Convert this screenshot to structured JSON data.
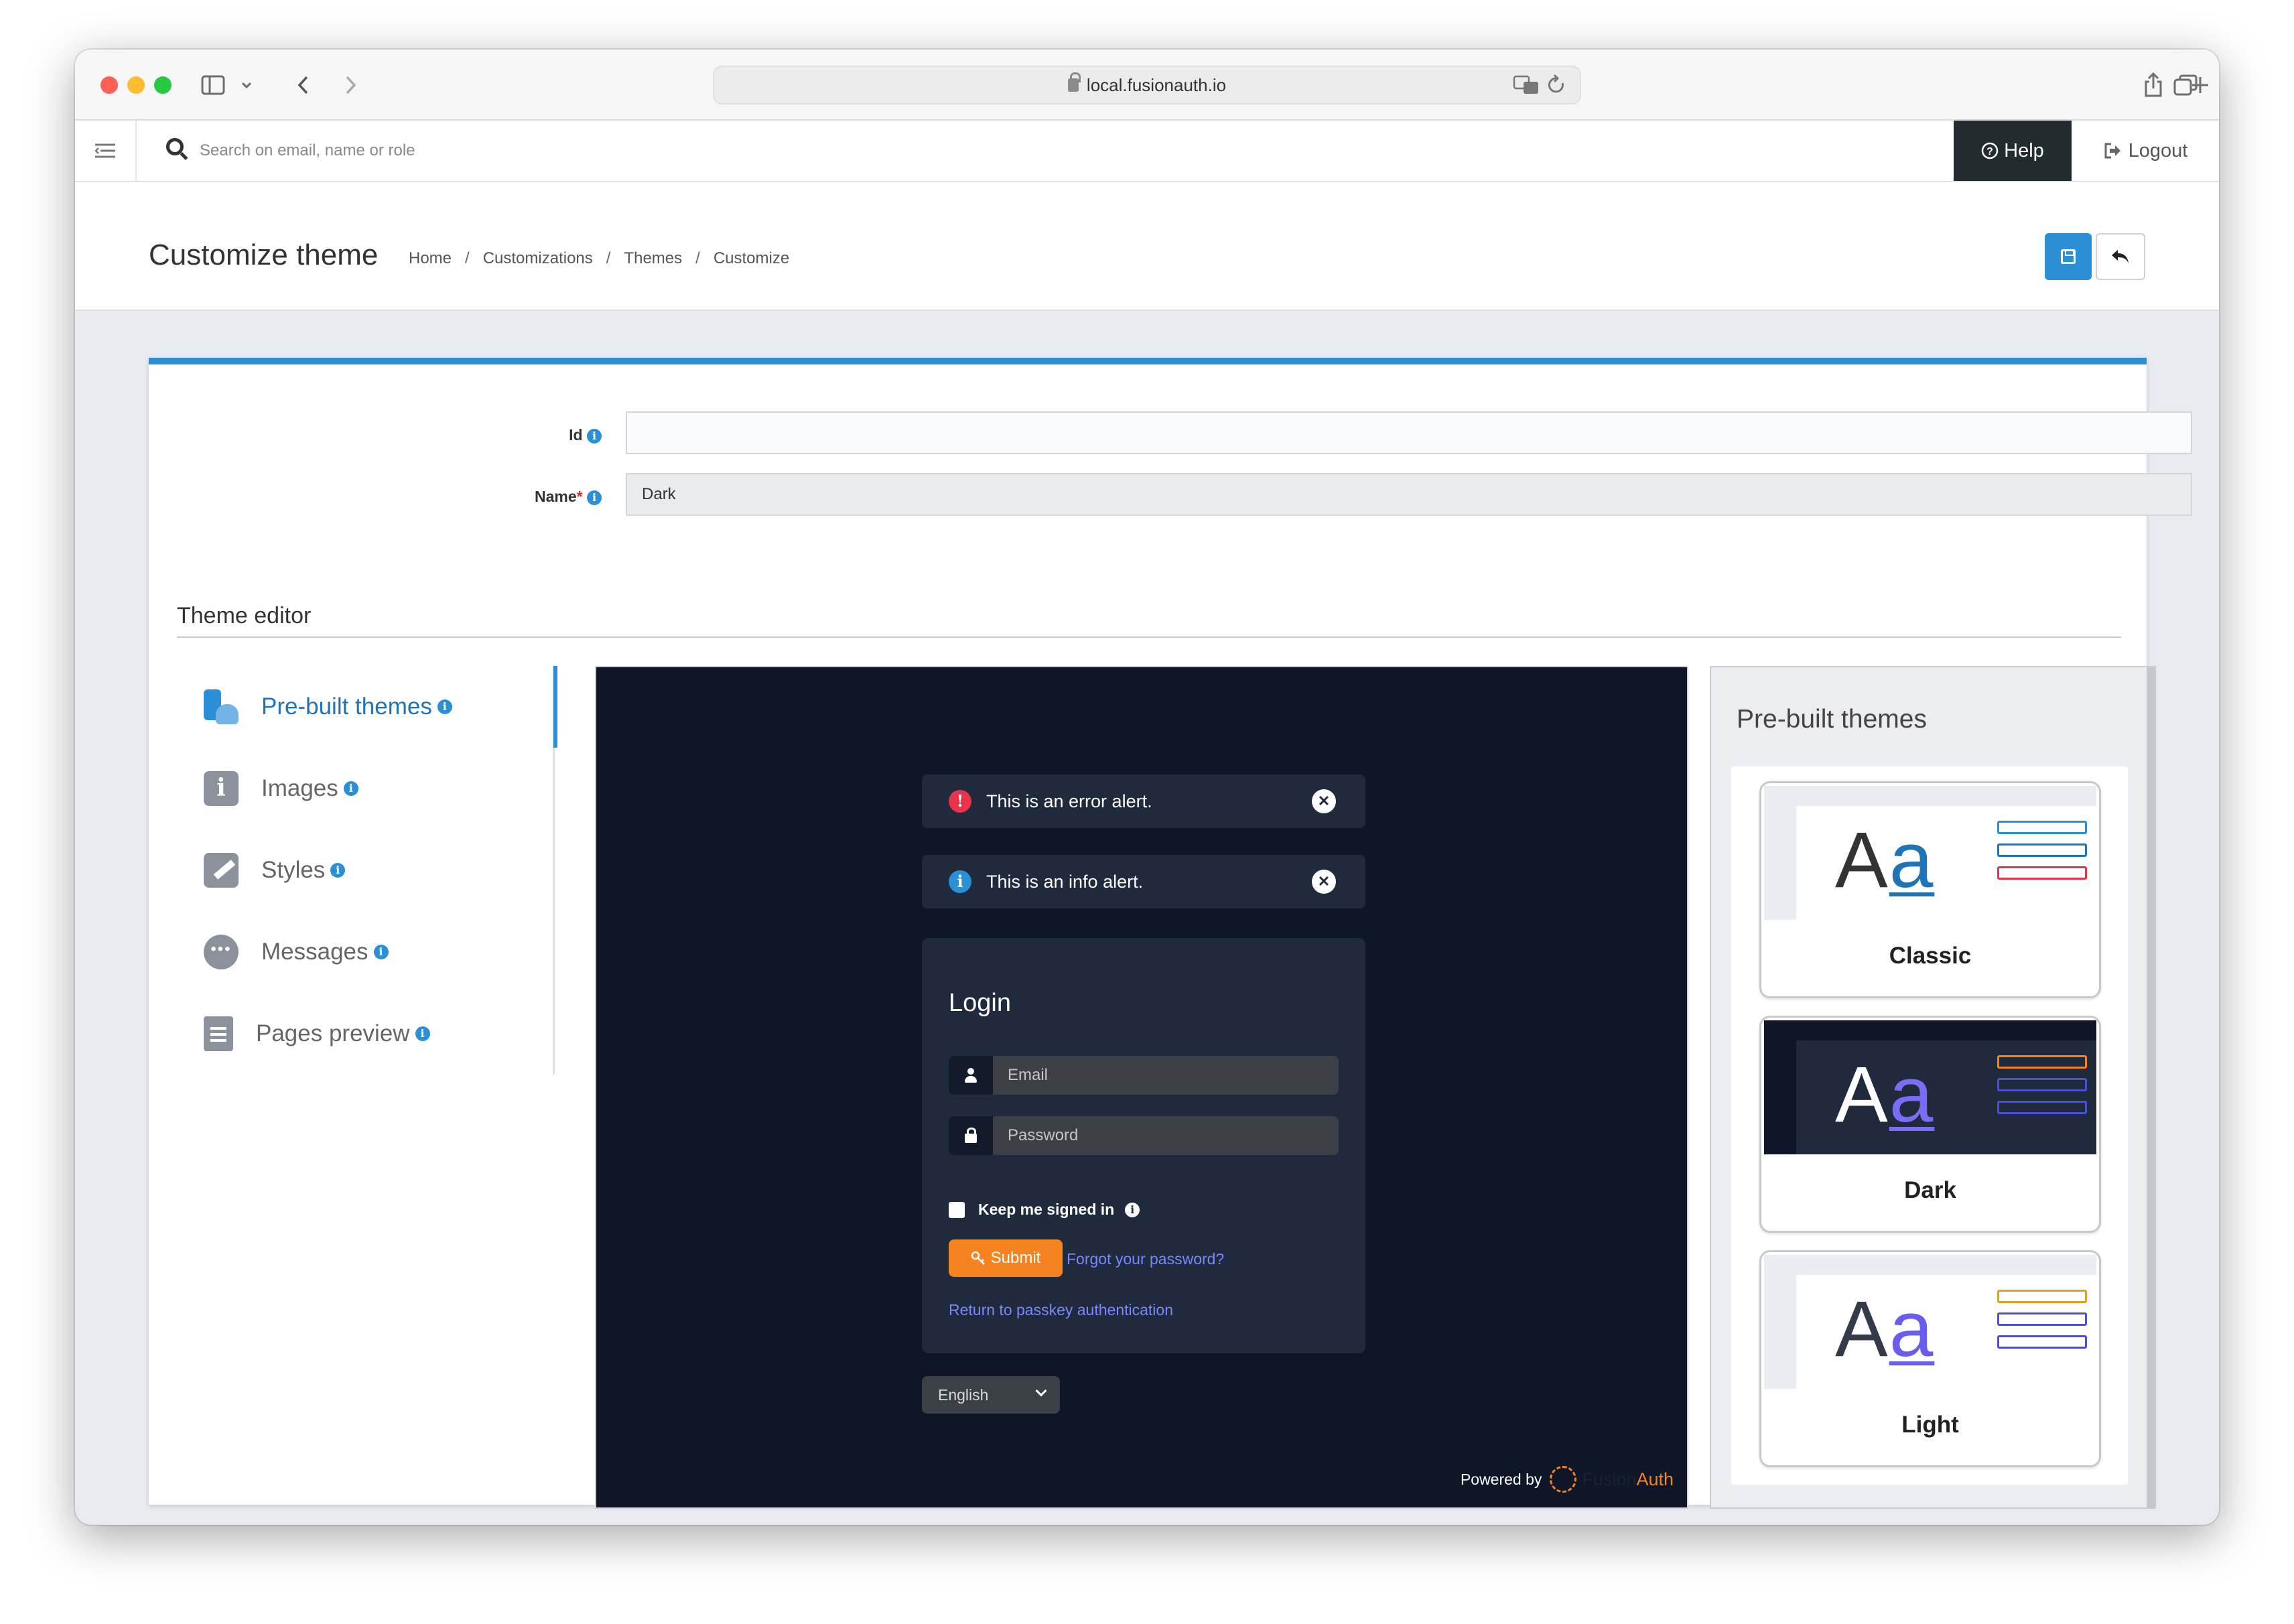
{
  "browser": {
    "url": "local.fusionauth.io"
  },
  "topbar": {
    "search_placeholder": "Search on email, name or role",
    "help_label": "Help",
    "logout_label": "Logout"
  },
  "header": {
    "title": "Customize theme",
    "breadcrumbs": [
      "Home",
      "Customizations",
      "Themes",
      "Customize"
    ],
    "separator": "/"
  },
  "form": {
    "id_label": "Id",
    "id_value": "",
    "name_label": "Name",
    "name_required_mark": "*",
    "name_value": "Dark",
    "info_glyph": "i"
  },
  "editor": {
    "section_title": "Theme editor",
    "tabs": [
      {
        "label": "Pre-built themes",
        "icon": "person-palette-icon",
        "active": true
      },
      {
        "label": "Images",
        "icon": "info-square-icon",
        "active": false
      },
      {
        "label": "Styles",
        "icon": "brush-icon",
        "active": false
      },
      {
        "label": "Messages",
        "icon": "chat-bubble-icon",
        "active": false
      },
      {
        "label": "Pages preview",
        "icon": "document-icon",
        "active": false
      }
    ]
  },
  "preview": {
    "error_alert": "This is an error alert.",
    "info_alert": "This is an info alert.",
    "error_glyph": "!",
    "info_glyph": "i",
    "close_glyph": "✕",
    "login_title": "Login",
    "email_placeholder": "Email",
    "password_placeholder": "Password",
    "keep_signed_in": "Keep me signed in",
    "submit_label": "Submit",
    "forgot_link": "Forgot your password?",
    "passkey_link": "Return to passkey authentication",
    "language": "English",
    "powered_by": "Powered by",
    "brand_fusion": "Fusion",
    "brand_auth": "Auth"
  },
  "themes": {
    "title": "Pre-built themes",
    "sample_big": "A",
    "sample_small": "a",
    "items": [
      {
        "name": "Classic"
      },
      {
        "name": "Dark"
      },
      {
        "name": "Light"
      }
    ]
  },
  "colors": {
    "accent": "#2b8fd6",
    "help_bg": "#222c30",
    "preview_bg": "#0e1628",
    "card_bg": "#1f2a3c",
    "submit": "#f58320",
    "link": "#7b86ff",
    "error": "#e8334a"
  }
}
